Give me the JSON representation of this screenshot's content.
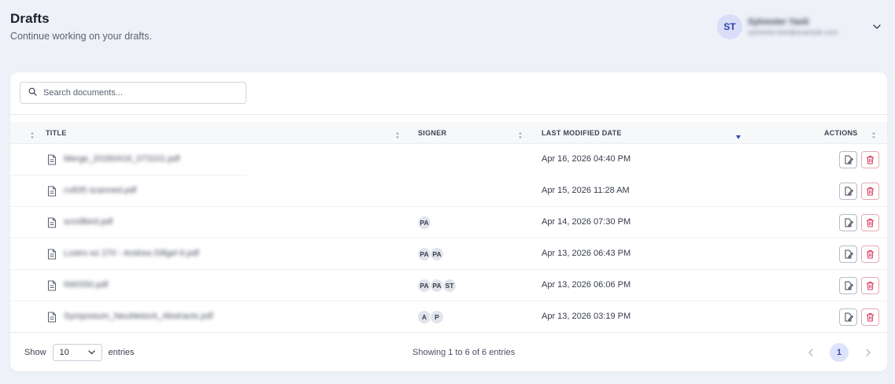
{
  "header": {
    "title": "Drafts",
    "subtitle": "Continue working on your drafts."
  },
  "user": {
    "initials": "ST",
    "name": "Sylvester Yaoli",
    "email": "sylvester.koe@example.com"
  },
  "search": {
    "placeholder": "Search documents...",
    "value": ""
  },
  "table": {
    "columns": [
      "TITLE",
      "SIGNER",
      "LAST MODIFIED DATE",
      "ACTIONS"
    ],
    "sorted_column": "LAST MODIFIED DATE",
    "sort_direction": "descending",
    "rows": [
      {
        "title": "Merge_20260416_073101.pdf",
        "signers": [],
        "modified": "Apr 16, 2026 04:40 PM"
      },
      {
        "title": "cv835 scanned.pdf",
        "signers": [],
        "modified": "Apr 15, 2026 11:28 AM"
      },
      {
        "title": "scrollbird.pdf",
        "signers": [
          "PA"
        ],
        "modified": "Apr 14, 2026 07:30 PM"
      },
      {
        "title": "Lustro ez 270 - Andrea Dillgel 6.pdf",
        "signers": [
          "PA",
          "PA"
        ],
        "modified": "Apr 13, 2026 06:43 PM"
      },
      {
        "title": "NWS50.pdf",
        "signers": [
          "PA",
          "PA",
          "ST"
        ],
        "modified": "Apr 13, 2026 06:06 PM"
      },
      {
        "title": "Symposium_NeuMetorA_Abstracts.pdf",
        "signers": [
          "A",
          "P"
        ],
        "modified": "Apr 13, 2026 03:19 PM"
      }
    ]
  },
  "footer": {
    "show_label": "Show",
    "page_length": "10",
    "entries_label": "entries",
    "info": "Showing 1 to 6 of 6 entries",
    "current_page": "1"
  },
  "colors": {
    "accent": "#3b4bb0",
    "avatar_bg": "#d8def8",
    "delete": "#d9345a",
    "background": "#eef1f8"
  },
  "icons": {
    "search": "search-icon",
    "document": "document-icon",
    "edit": "edit-document-icon",
    "delete": "trash-icon",
    "chevron": "chevron-down-icon"
  }
}
